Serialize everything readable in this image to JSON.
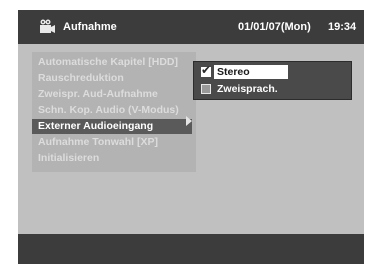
{
  "header": {
    "title": "Aufnahme",
    "date": "01/01/07(Mon)",
    "time": "19:34",
    "icon": "camcorder-recording-icon"
  },
  "menu": {
    "items": [
      {
        "label": "Automatische Kapitel [HDD]",
        "selected": false
      },
      {
        "label": "Rauschreduktion",
        "selected": false
      },
      {
        "label": "Zweispr. Aud-Aufnahme",
        "selected": false
      },
      {
        "label": "Schn. Kop. Audio (V-Modus)",
        "selected": false
      },
      {
        "label": "Externer Audioeingang",
        "selected": true
      },
      {
        "label": "Aufnahme Tonwahl [XP]",
        "selected": false
      },
      {
        "label": "Initialisieren",
        "selected": false
      }
    ]
  },
  "submenu": {
    "options": [
      {
        "label": "Stereo",
        "checked": true,
        "selected": true
      },
      {
        "label": "Zweisprach.",
        "checked": false,
        "selected": false
      }
    ]
  },
  "colors": {
    "background": "#c0c0c0",
    "bars": "#3c3c3c",
    "menu_panel": "#b3b3b3",
    "highlight": "#5a5a5a"
  }
}
